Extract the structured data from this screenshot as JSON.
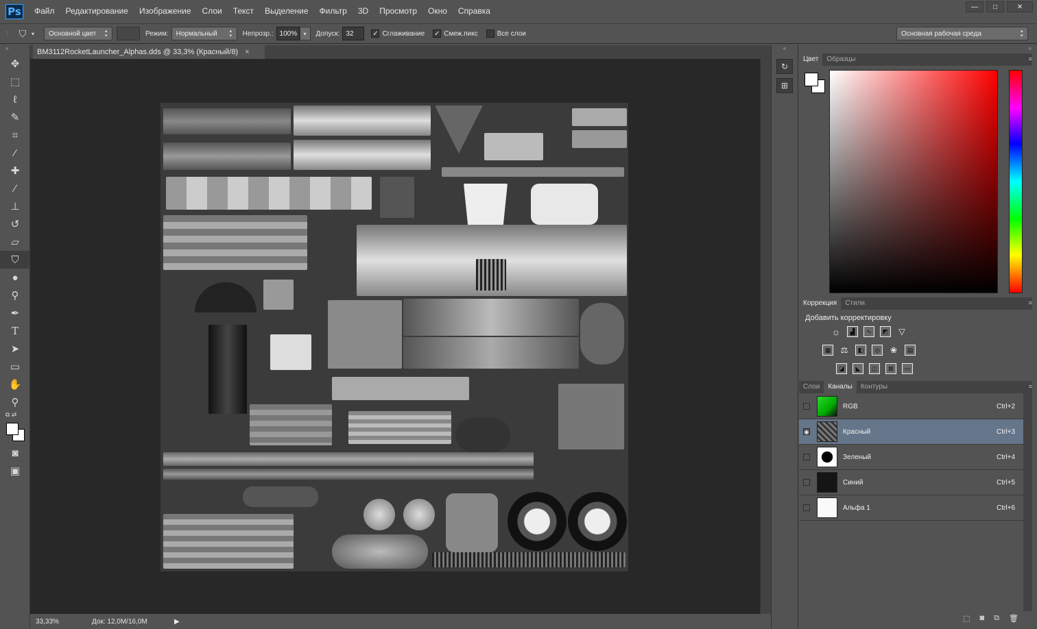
{
  "app": {
    "logo": "Ps"
  },
  "menu": [
    "Файл",
    "Редактирование",
    "Изображение",
    "Слои",
    "Текст",
    "Выделение",
    "Фильтр",
    "3D",
    "Просмотр",
    "Окно",
    "Справка"
  ],
  "window_controls": {
    "minimize": "—",
    "maximize": "□",
    "close": "✕"
  },
  "options": {
    "source": "Основной цвет",
    "mode_label": "Режим:",
    "mode_value": "Нормальный",
    "opacity_label": "Непрозр.:",
    "opacity_value": "100%",
    "tolerance_label": "Допуск:",
    "tolerance_value": "32",
    "antialias_label": "Сглаживание",
    "contiguous_label": "Смеж.пикс",
    "all_layers_label": "Все слои",
    "workspace": "Основная рабочая среда"
  },
  "document": {
    "tab_title": "BM3112RocketLauncher_Alphas.dds @ 33,3% (Красный/8)",
    "close_glyph": "×"
  },
  "status": {
    "zoom": "33,33%",
    "doc_size": "Док: 12,0M/16,0M"
  },
  "panels": {
    "color_tabs": [
      "Цвет",
      "Образцы"
    ],
    "adjust_tabs": [
      "Коррекция",
      "Стили"
    ],
    "adjust_title": "Добавить корректировку",
    "channel_tabs": [
      "Слои",
      "Каналы",
      "Контуры"
    ]
  },
  "channels": [
    {
      "name": "RGB",
      "shortcut": "Ctrl+2"
    },
    {
      "name": "Красный",
      "shortcut": "Ctrl+3"
    },
    {
      "name": "Зеленый",
      "shortcut": "Ctrl+4"
    },
    {
      "name": "Синий",
      "shortcut": "Ctrl+5"
    },
    {
      "name": "Альфа 1",
      "shortcut": "Ctrl+6"
    }
  ],
  "colors": {
    "accent_selected": "#65758a",
    "canvas_bg": "#282828",
    "ui_bg": "#535353"
  }
}
